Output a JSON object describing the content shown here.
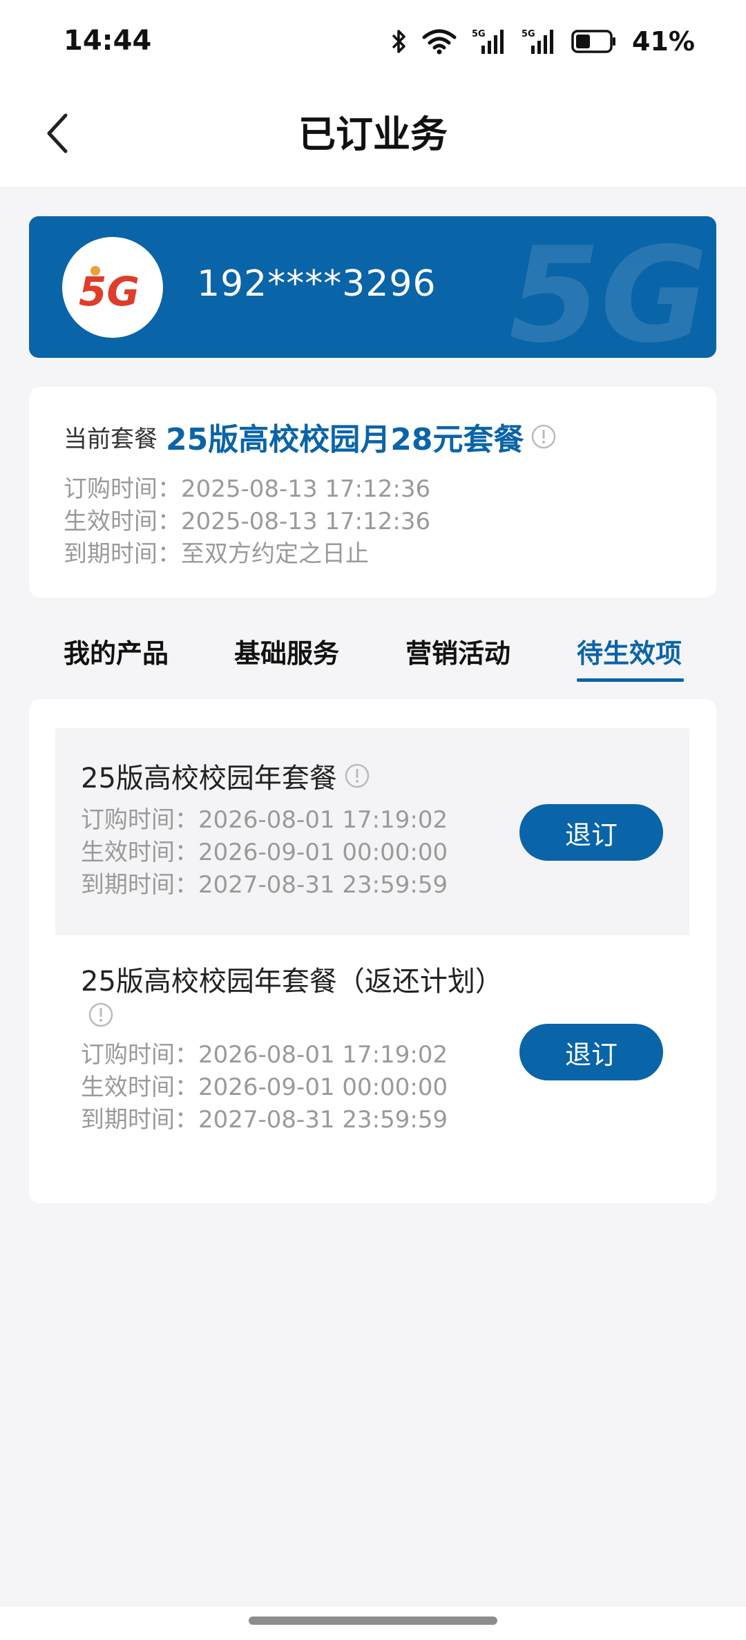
{
  "status_bar": {
    "time": "14:44",
    "battery_percent": "41%",
    "icons": [
      "bluetooth-icon",
      "wifi-icon",
      "signal-5g-icon",
      "signal-5g-icon",
      "battery-icon"
    ]
  },
  "nav": {
    "title": "已订业务",
    "back_icon": "chevron-left-icon"
  },
  "account": {
    "phone_number": "192****3296",
    "logo": "5G",
    "brand_color": "#0a64a8"
  },
  "current_plan": {
    "label": "当前套餐",
    "name": "25版高校校园月28元套餐",
    "order_time": "订购时间：2025-08-13 17:12:36",
    "effective_time": "生效时间：2025-08-13 17:12:36",
    "expire_time": "到期时间：至双方约定之日止"
  },
  "tabs": [
    {
      "label": "我的产品",
      "active": false
    },
    {
      "label": "基础服务",
      "active": false
    },
    {
      "label": "营销活动",
      "active": false
    },
    {
      "label": "待生效项",
      "active": true
    }
  ],
  "pending_items": [
    {
      "title": "25版高校校园年套餐",
      "order_time": "订购时间：2026-08-01 17:19:02",
      "effective_time": "生效时间：2026-09-01 00:00:00",
      "expire_time": "到期时间：2027-08-31 23:59:59",
      "button_label": "退订"
    },
    {
      "title": "25版高校校园年套餐（返还计划）",
      "order_time": "订购时间：2026-08-01 17:19:02",
      "effective_time": "生效时间：2026-09-01 00:00:00",
      "expire_time": "到期时间：2027-08-31 23:59:59",
      "button_label": "退订"
    }
  ]
}
